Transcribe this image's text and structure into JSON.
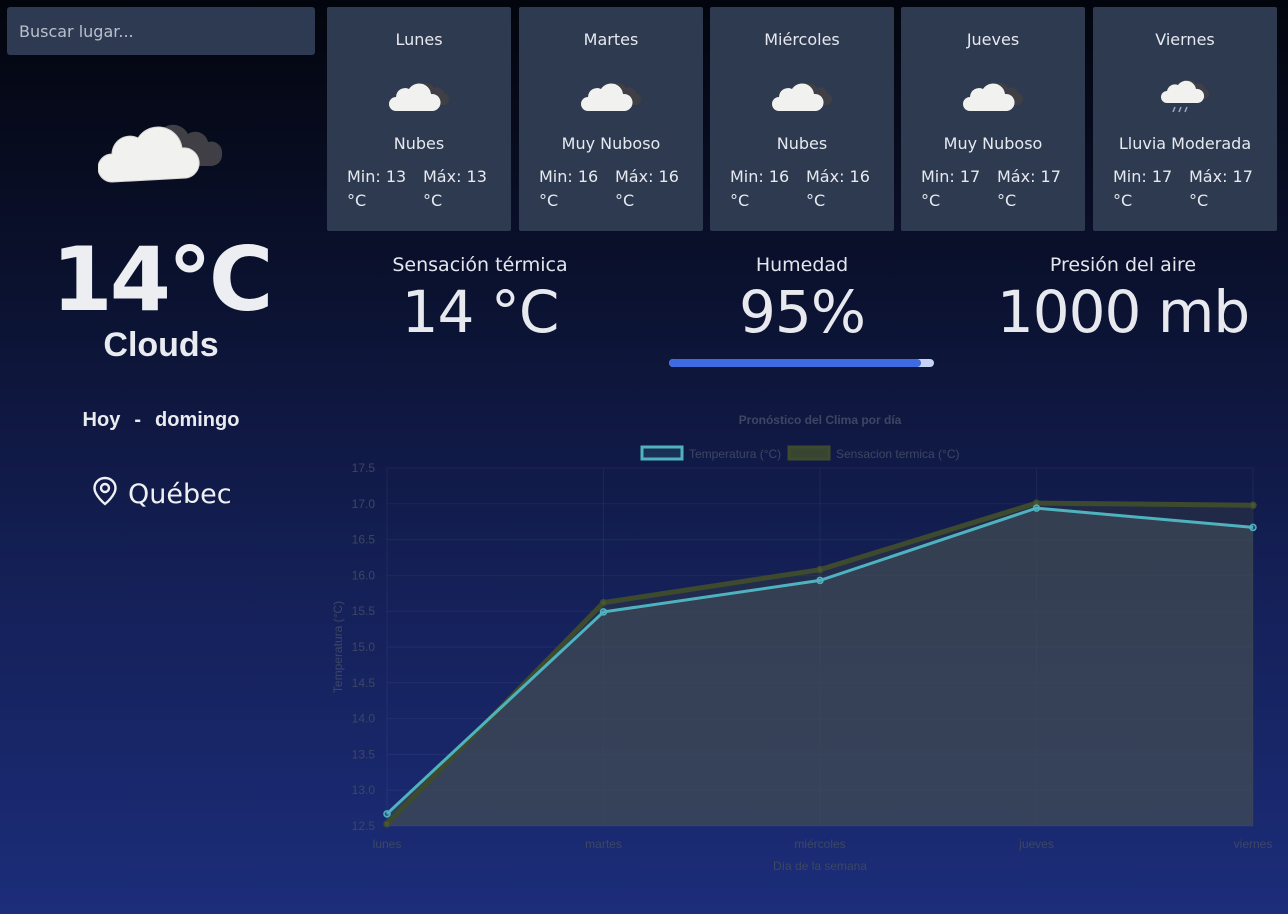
{
  "search": {
    "placeholder": "Buscar lugar...",
    "value": ""
  },
  "current": {
    "icon": "clouds-icon",
    "temperature": "14°C",
    "description": "Clouds",
    "today_label": "Hoy",
    "separator": "-",
    "weekday": "domingo",
    "location": "Québec"
  },
  "forecast": [
    {
      "day": "Lunes",
      "icon": "clouds-icon",
      "description": "Nubes",
      "min": "Min: 13 °C",
      "max": "Máx: 13 °C"
    },
    {
      "day": "Martes",
      "icon": "clouds-icon",
      "description": "Muy Nuboso",
      "min": "Min: 16 °C",
      "max": "Máx: 16 °C"
    },
    {
      "day": "Miércoles",
      "icon": "clouds-icon",
      "description": "Nubes",
      "min": "Min: 16 °C",
      "max": "Máx: 16 °C"
    },
    {
      "day": "Jueves",
      "icon": "clouds-icon",
      "description": "Muy Nuboso",
      "min": "Min: 17 °C",
      "max": "Máx: 17 °C"
    },
    {
      "day": "Viernes",
      "icon": "rain-cloud-icon",
      "description": "Lluvia Moderada",
      "min": "Min: 17 °C",
      "max": "Máx: 17 °C"
    }
  ],
  "stats": {
    "feels_like": {
      "label": "Sensación térmica",
      "value": "14 °C"
    },
    "humidity": {
      "label": "Humedad",
      "value": "95%",
      "fraction": 0.95
    },
    "pressure": {
      "label": "Presión del aire",
      "value": "1000 mb"
    }
  },
  "colors": {
    "temp_line": "#4fb3bf",
    "feels_line": "#3d4a2e",
    "humidity_bar": "#3f6be0",
    "card_bg": "#2d3a50"
  },
  "chart_data": {
    "type": "line",
    "title": "Pronóstico del Clima por día",
    "xlabel": "Día de la semana",
    "ylabel": "Temperatura (°C)",
    "categories": [
      "lunes",
      "martes",
      "miércoles",
      "jueves",
      "viernes"
    ],
    "ylim": [
      12.5,
      17.5
    ],
    "yticks": [
      "17.5",
      "17.0",
      "16.5",
      "16.0",
      "15.5",
      "15.0",
      "14.5",
      "14.0",
      "13.5",
      "13.0",
      "12.5"
    ],
    "legend_position": "top",
    "grid": true,
    "series": [
      {
        "name": "Temperatura (°C)",
        "values": [
          12.67,
          15.49,
          15.93,
          16.94,
          16.67
        ],
        "color": "#4fb3bf"
      },
      {
        "name": "Sensacion termica (°C)",
        "values": [
          12.53,
          15.62,
          16.08,
          17.01,
          16.98
        ],
        "color": "#3d4a2e"
      }
    ]
  }
}
